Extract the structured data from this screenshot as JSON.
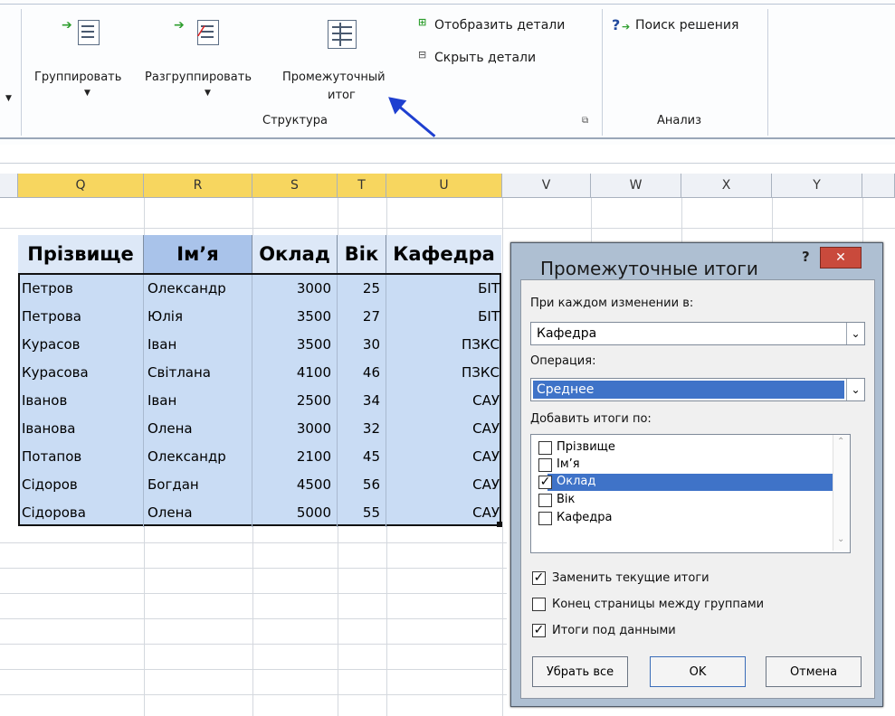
{
  "ribbon": {
    "group_label": "Группировать",
    "ungroup_label": "Разгруппировать",
    "subtotal_label_1": "Промежуточный",
    "subtotal_label_2": "итог",
    "show_detail_label": "Отобразить детали",
    "hide_detail_label": "Скрыть детали",
    "structure_group_label": "Структура",
    "solver_label": "Поиск решения",
    "analysis_group_label": "Анализ"
  },
  "columns": {
    "selected": [
      "Q",
      "R",
      "S",
      "T",
      "U"
    ],
    "unselected": [
      "V",
      "W",
      "X",
      "Y"
    ]
  },
  "table": {
    "headers": [
      "Прізвище",
      "Ім’я",
      "Оклад",
      "Вік",
      "Кафедра"
    ],
    "rows": [
      [
        "Петров",
        "Олександр",
        "3000",
        "25",
        "БІТ"
      ],
      [
        "Петрова",
        "Юлія",
        "3500",
        "27",
        "БІТ"
      ],
      [
        "Курасов",
        "Іван",
        "3500",
        "30",
        "ПЗКС"
      ],
      [
        "Курасова",
        "Світлана",
        "4100",
        "46",
        "ПЗКС"
      ],
      [
        "Іванов",
        "Іван",
        "2500",
        "34",
        "САУ"
      ],
      [
        "Іванова",
        "Олена",
        "3000",
        "32",
        "САУ"
      ],
      [
        "Потапов",
        "Олександр",
        "2100",
        "45",
        "САУ"
      ],
      [
        "Сідоров",
        "Богдан",
        "4500",
        "56",
        "САУ"
      ],
      [
        "Сідорова",
        "Олена",
        "5000",
        "55",
        "САУ"
      ]
    ]
  },
  "dialog": {
    "title": "Промежуточные итоги",
    "help": "?",
    "close": "✕",
    "change_label": "При каждом изменении в:",
    "change_value": "Кафедра",
    "operation_label": "Операция:",
    "operation_value": "Среднее",
    "add_totals_label": "Добавить итоги по:",
    "fields": [
      {
        "name": "Прізвище",
        "checked": false
      },
      {
        "name": "Ім’я",
        "checked": false
      },
      {
        "name": "Оклад",
        "checked": true
      },
      {
        "name": "Вік",
        "checked": false
      },
      {
        "name": "Кафедра",
        "checked": false
      }
    ],
    "replace_label": "Заменить текущие итоги",
    "replace_checked": true,
    "pagebreak_label": "Конец страницы между группами",
    "pagebreak_checked": false,
    "below_label": "Итоги под данными",
    "below_checked": true,
    "remove_all_label": "Убрать все",
    "ok_label": "OK",
    "cancel_label": "Отмена",
    "check_mark": "✓"
  },
  "colors": {
    "selected_header": "#f7d65f",
    "table_fill": "#c9dcf4",
    "list_selection": "#3f73c8",
    "close_button": "#c94a3c",
    "arrow": "#1e3fd0"
  }
}
